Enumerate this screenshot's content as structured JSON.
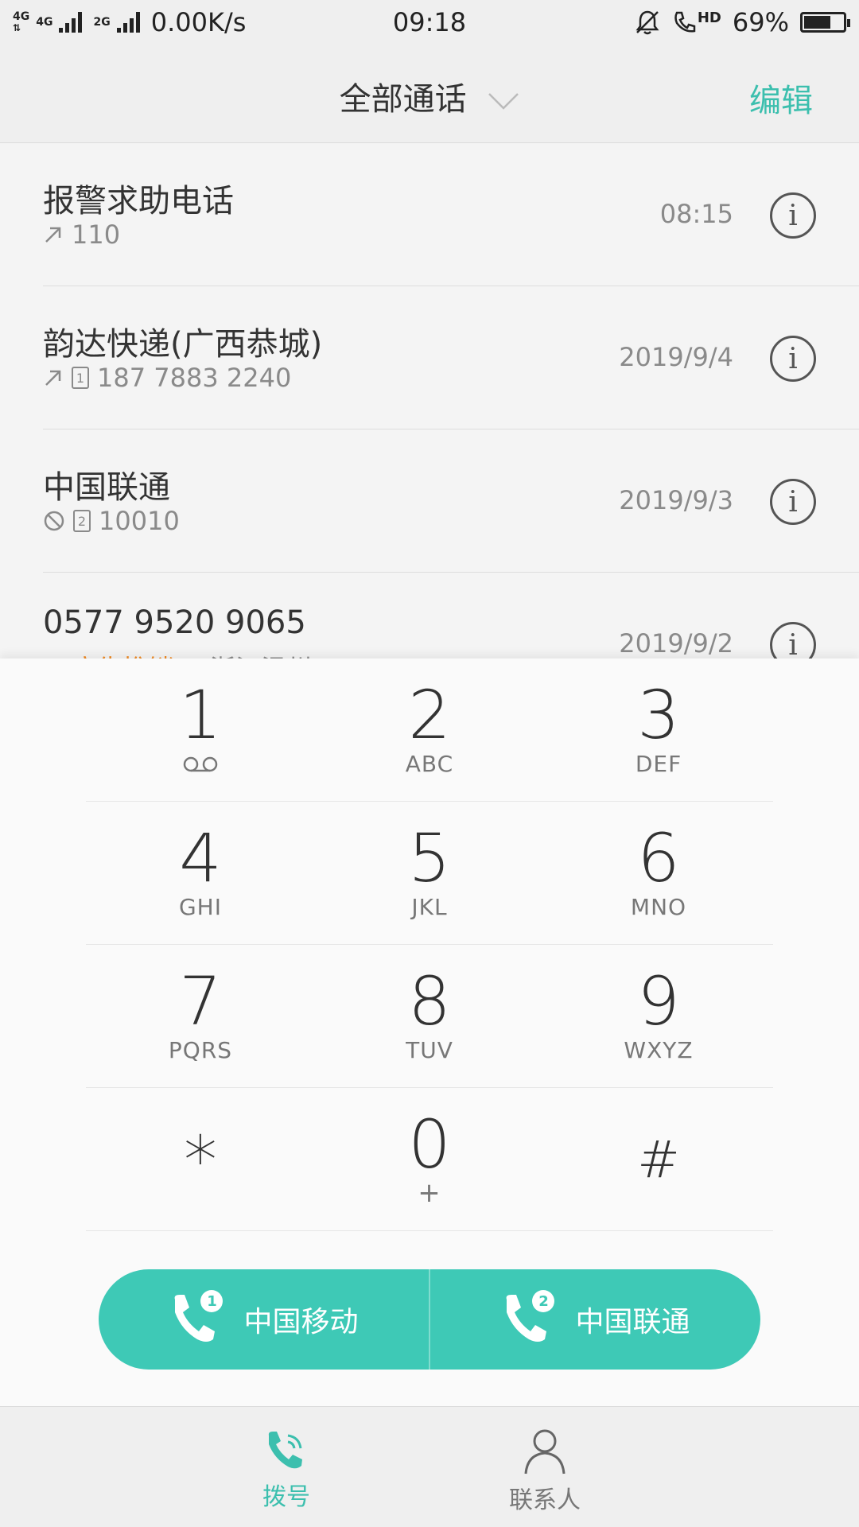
{
  "status_bar": {
    "net1": "4G",
    "net2": "4G",
    "net3": "2G",
    "speed": "0.00K/s",
    "time": "09:18",
    "hd": "HD",
    "battery": "69%",
    "battery_level": 0.69
  },
  "header": {
    "title": "全部通话",
    "edit": "编辑"
  },
  "calls": [
    {
      "name": "报警求助电话",
      "number": "110",
      "time": "08:15"
    },
    {
      "name": "韵达快递(广西恭城)",
      "sim": "1",
      "number": "187 7883 2240",
      "time": "2019/9/4"
    },
    {
      "name": "中国联通",
      "sim": "2",
      "number": "10010",
      "time": "2019/9/3"
    },
    {
      "name": "0577 9520 9065",
      "tag": "广告推销",
      "location": "浙江温州",
      "time": "2019/9/2"
    }
  ],
  "dialpad": {
    "keys": [
      {
        "digit": "1",
        "letters": ""
      },
      {
        "digit": "2",
        "letters": "ABC"
      },
      {
        "digit": "3",
        "letters": "DEF"
      },
      {
        "digit": "4",
        "letters": "GHI"
      },
      {
        "digit": "5",
        "letters": "JKL"
      },
      {
        "digit": "6",
        "letters": "MNO"
      },
      {
        "digit": "7",
        "letters": "PQRS"
      },
      {
        "digit": "8",
        "letters": "TUV"
      },
      {
        "digit": "9",
        "letters": "WXYZ"
      },
      {
        "digit": "*",
        "letters": ""
      },
      {
        "digit": "0",
        "letters": "+"
      },
      {
        "digit": "#",
        "letters": ""
      }
    ]
  },
  "call_buttons": [
    {
      "sim": "1",
      "label": "中国移动"
    },
    {
      "sim": "2",
      "label": "中国联通"
    }
  ],
  "bottom_nav": {
    "dial": "拨号",
    "contacts": "联系人"
  },
  "colors": {
    "accent": "#3ec9b6",
    "tag_orange": "#f08a24"
  }
}
